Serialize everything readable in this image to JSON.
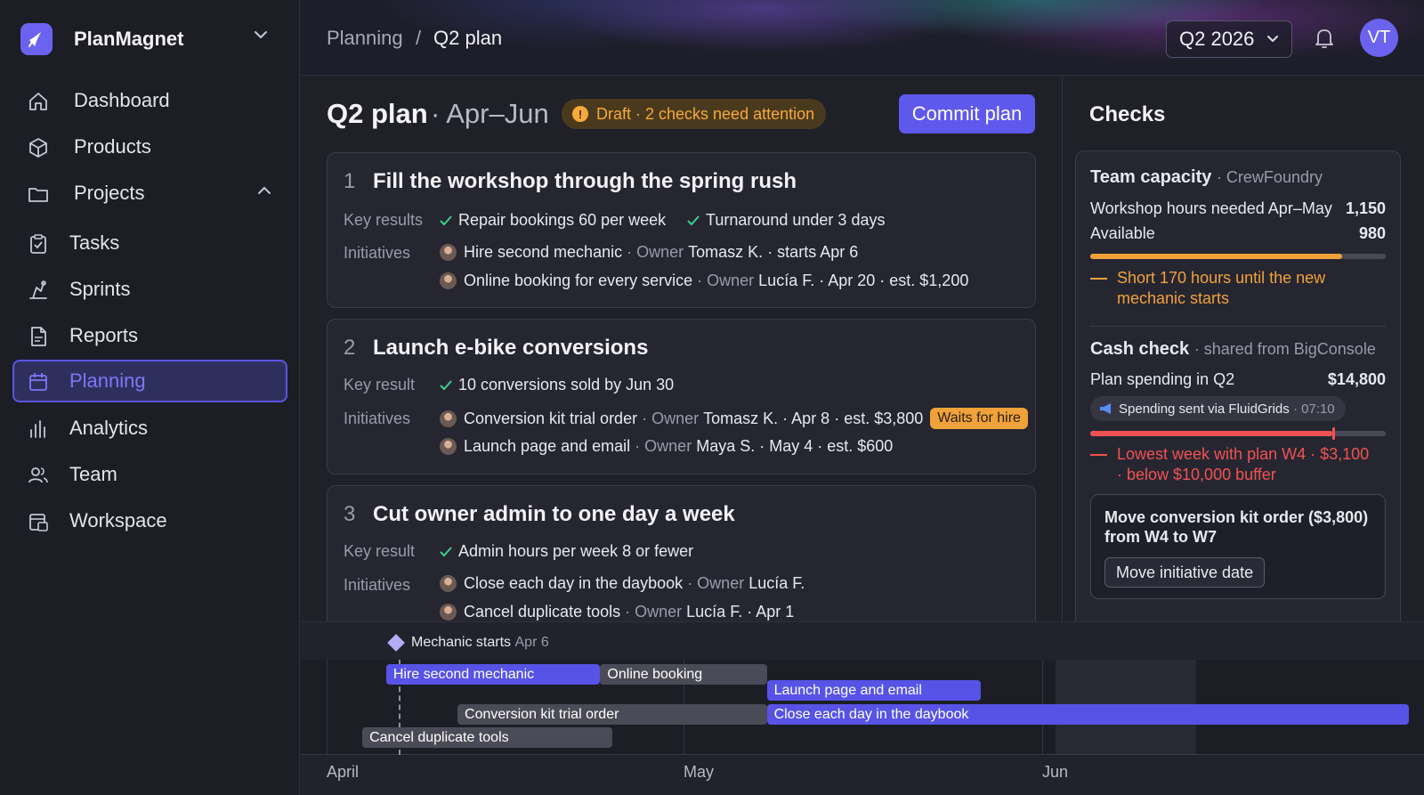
{
  "app": {
    "name": "PlanMagnet"
  },
  "nav": {
    "items": [
      {
        "label": "Dashboard",
        "icon": "home-icon"
      },
      {
        "label": "Products",
        "icon": "cube-icon"
      },
      {
        "label": "Projects",
        "icon": "folder-icon"
      },
      {
        "label": "Tasks",
        "icon": "clipboard-icon"
      },
      {
        "label": "Sprints",
        "icon": "sprint-icon"
      },
      {
        "label": "Reports",
        "icon": "report-icon"
      },
      {
        "label": "Planning",
        "icon": "calendar-icon"
      },
      {
        "label": "Analytics",
        "icon": "bars-icon"
      },
      {
        "label": "Team",
        "icon": "users-icon"
      },
      {
        "label": "Workspace",
        "icon": "workspace-icon"
      }
    ],
    "active": "Planning"
  },
  "topbar": {
    "breadcrumb": [
      "Planning",
      "Q2 plan"
    ],
    "separator": "/",
    "period": "Q2 2026",
    "avatar": "VT"
  },
  "plan": {
    "title": "Q2 plan",
    "subtitle": "· Apr–Jun",
    "status_icon": "!",
    "status": "Draft · 2 checks need attention",
    "commit_label": "Commit plan"
  },
  "objectives": [
    {
      "num": "1",
      "title": "Fill the workshop through the spring rush",
      "kr_label": "Key results",
      "key_results": [
        "Repair bookings 60 per week",
        "Turnaround under 3 days"
      ],
      "init_label": "Initiatives",
      "initiatives": [
        {
          "name": "Hire second mechanic",
          "owner_label": "· Owner",
          "owner": "Tomasz K.",
          "meta": "· starts Apr 6"
        },
        {
          "name": "Online booking for every service",
          "owner_label": "· Owner",
          "owner": "Lucía F.",
          "meta": "· Apr 20 · est. $1,200"
        }
      ]
    },
    {
      "num": "2",
      "title": "Launch e-bike conversions",
      "kr_label": "Key result",
      "key_results": [
        "10 conversions sold by Jun 30"
      ],
      "init_label": "Initiatives",
      "initiatives": [
        {
          "name": "Conversion kit trial order",
          "owner_label": "· Owner",
          "owner": "Tomasz K.",
          "meta": "· Apr 8 · est. $3,800",
          "tag": "Waits for hire"
        },
        {
          "name": "Launch page and email",
          "owner_label": "· Owner",
          "owner": "Maya S.",
          "meta": "· May 4 · est. $600"
        }
      ]
    },
    {
      "num": "3",
      "title": "Cut owner admin to one day a week",
      "kr_label": "Key result",
      "key_results": [
        "Admin hours per week 8 or fewer"
      ],
      "init_label": "Initiatives",
      "initiatives": [
        {
          "name": "Close each day in the daybook",
          "owner_label": "· Owner",
          "owner": "Lucía F.",
          "meta": ""
        },
        {
          "name": "Cancel duplicate tools",
          "owner_label": "· Owner",
          "owner": "Lucía F.",
          "meta": "· Apr 1"
        }
      ]
    }
  ],
  "checks": {
    "title": "Checks",
    "capacity": {
      "title": "Team capacity",
      "source": "· CrewFoundry",
      "needed_label": "Workshop hours needed Apr–May",
      "needed": "1,150",
      "available_label": "Available",
      "available": "980",
      "fill_fraction": 0.852,
      "warning": "Short 170 hours until the new mechanic starts",
      "color": "#f0a23a"
    },
    "cash": {
      "title": "Cash check",
      "source": "· shared from BigConsole",
      "spend_label": "Plan spending in Q2",
      "spend": "$14,800",
      "sent_text": "Spending sent via FluidGrids",
      "sent_time": "· 07:10",
      "fill_fraction": 0.82,
      "warning": "Lowest week with plan W4 · $3,100 · below $10,000 buffer",
      "color": "#f05252"
    },
    "suggestion": {
      "text": "Move conversion kit order ($3,800) from W4 to W7",
      "button": "Move initiative date"
    }
  },
  "timeline": {
    "milestone": {
      "label": "Mechanic starts",
      "date": "Apr 6"
    },
    "months": [
      "April",
      "May",
      "Jun"
    ],
    "bars": [
      {
        "label": "Hire second mechanic",
        "start": "Apr 6",
        "end": "Apr 23",
        "color": "#5753e6"
      },
      {
        "label": "Online booking",
        "start": "Apr 24",
        "end": "May 7",
        "color": "#4b4b57"
      },
      {
        "label": "Launch page and email",
        "start": "May 8",
        "end": "May 25",
        "color": "#5753e6"
      },
      {
        "label": "Conversion kit trial order",
        "start": "Apr 12",
        "end": "May 7",
        "color": "#4b4b57"
      },
      {
        "label": "Close each day in the daybook",
        "start": "May 8",
        "end": "Jun 30",
        "color": "#5753e6"
      },
      {
        "label": "Cancel duplicate tools",
        "start": "Apr 4",
        "end": "Apr 24",
        "color": "#4b4b57"
      }
    ]
  }
}
